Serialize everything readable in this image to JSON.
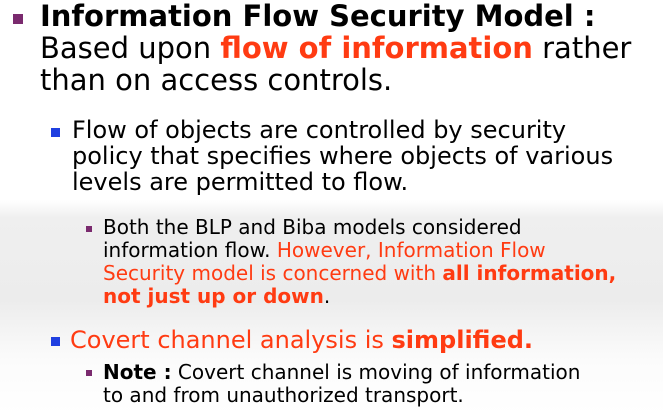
{
  "colors": {
    "bullet_l1": "#7a2a6e",
    "bullet_l2": "#1f3fe0",
    "bullet_l3": "#7a2a6e",
    "accent_red": "#ff3b12"
  },
  "slide": {
    "main_bullet": {
      "title": "Information Flow Security Model :",
      "line2_prefix": "Based upon ",
      "line2_highlight": "flow of information",
      "line2_suffix": " rather",
      "line3": "than on access controls."
    },
    "sub_bullet_1": {
      "line1": "Flow of objects are controlled by security",
      "line2": "policy that specifies where objects of various",
      "line3": "levels are permitted to flow."
    },
    "sub_sub_bullet_1": {
      "line1": "Both the BLP and Biba models considered",
      "line2_prefix": "information flow. ",
      "line2_red": "However, Information Flow",
      "line3_red": "Security model is concerned with ",
      "line3_bold": "all information,",
      "line4_bold": "not just up or down",
      "line4_end": "."
    },
    "sub_bullet_2": {
      "text_red": "Covert channel analysis is ",
      "text_bold": "simplified."
    },
    "sub_sub_bullet_2": {
      "note_label": "Note :",
      "line1_text": " Covert channel is moving of information",
      "line2": "to and from unauthorized transport."
    }
  }
}
